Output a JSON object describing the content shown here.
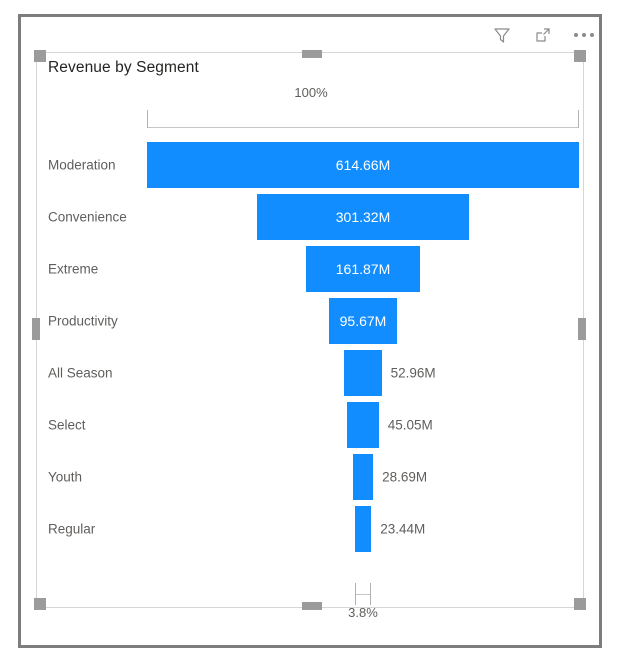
{
  "visual": {
    "title": "Revenue by Segment",
    "bar_color": "#118DFF",
    "label_color": "#605e5c",
    "inside_label_color": "#ffffff"
  },
  "header": {
    "filter_icon": "filter-funnel-icon",
    "focus_icon": "focus-mode-icon",
    "more_icon": "more-options-icon"
  },
  "chart_data": {
    "type": "bar",
    "subtype": "funnel",
    "title": "Revenue by Segment",
    "xlabel": "",
    "ylabel": "",
    "orientation": "horizontal-centered",
    "grid": false,
    "legend": "none",
    "top_span_label": "100%",
    "bottom_span_label": "3.8%",
    "categories": [
      "Moderation",
      "Convenience",
      "Extreme",
      "Productivity",
      "All Season",
      "Select",
      "Youth",
      "Regular"
    ],
    "values": [
      614.66,
      301.32,
      161.87,
      95.67,
      52.96,
      45.05,
      28.69,
      23.44
    ],
    "value_labels": [
      "614.66M",
      "301.32M",
      "161.87M",
      "95.67M",
      "52.96M",
      "45.05M",
      "28.69M",
      "23.44M"
    ],
    "percent_of_first": [
      100.0,
      49.0,
      26.3,
      15.6,
      8.6,
      7.3,
      4.7,
      3.8
    ],
    "units": "M",
    "max_value": 614.66
  },
  "rows": [
    {
      "label": "Moderation",
      "value_label": "614.66M",
      "pct": 100.0,
      "inside": true
    },
    {
      "label": "Convenience",
      "value_label": "301.32M",
      "pct": 49.0,
      "inside": true
    },
    {
      "label": "Extreme",
      "value_label": "161.87M",
      "pct": 26.3,
      "inside": true
    },
    {
      "label": "Productivity",
      "value_label": "95.67M",
      "pct": 15.6,
      "inside": true
    },
    {
      "label": "All Season",
      "value_label": "52.96M",
      "pct": 8.6,
      "inside": false
    },
    {
      "label": "Select",
      "value_label": "45.05M",
      "pct": 7.3,
      "inside": false
    },
    {
      "label": "Youth",
      "value_label": "28.69M",
      "pct": 4.7,
      "inside": false
    },
    {
      "label": "Regular",
      "value_label": "23.44M",
      "pct": 3.8,
      "inside": false
    }
  ]
}
